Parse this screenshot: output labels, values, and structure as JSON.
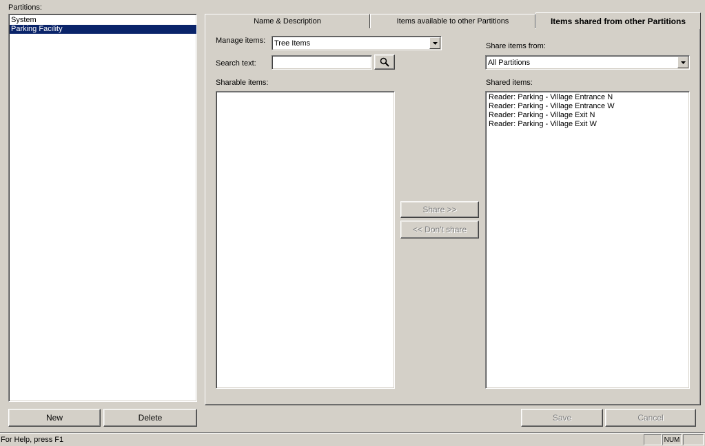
{
  "partitions": {
    "label": "Partitions:",
    "items": [
      {
        "label": "System",
        "selected": false
      },
      {
        "label": "Parking Facility",
        "selected": true
      }
    ],
    "new_label": "New",
    "delete_label": "Delete"
  },
  "tabs": [
    {
      "label": "Name & Description",
      "active": false
    },
    {
      "label": "Items available to other Partitions",
      "active": false
    },
    {
      "label": "Items shared from other Partitions",
      "active": true
    }
  ],
  "manage": {
    "label": "Manage items:",
    "value": "Tree Items",
    "search_label": "Search text:",
    "search_value": "",
    "search_icon": "magnifier-icon",
    "sharable_label": "Sharable items:",
    "sharable_items": []
  },
  "share": {
    "share_label": "Share >>",
    "dont_share_label": "<< Don't share"
  },
  "shared": {
    "from_label": "Share items from:",
    "from_value": "All Partitions",
    "items_label": "Shared items:",
    "items": [
      "Reader: Parking - Village Entrance N",
      "Reader: Parking - Village Entrance W",
      "Reader: Parking - Village Exit N",
      "Reader: Parking - Village Exit W"
    ]
  },
  "footer": {
    "save_label": "Save",
    "cancel_label": "Cancel"
  },
  "status": {
    "help_text": "For Help, press F1",
    "num_indicator": "NUM"
  }
}
